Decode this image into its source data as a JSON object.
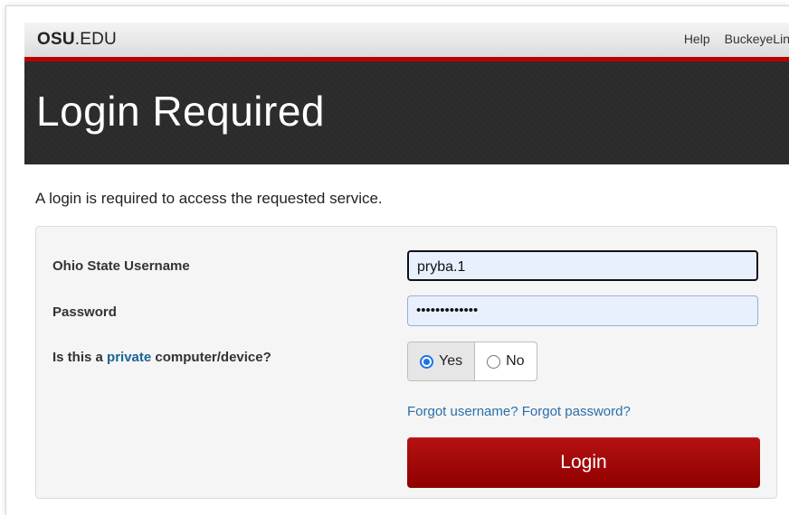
{
  "header": {
    "brand_bold": "OSU",
    "brand_rest": ".EDU",
    "links": [
      "Help",
      "BuckeyeLin"
    ]
  },
  "banner": {
    "title": "Login Required"
  },
  "notice": "A login is required to access the requested service.",
  "form": {
    "username_label": "Ohio State Username",
    "username_value": "pryba.1",
    "password_label": "Password",
    "password_value": "•••••••••••••",
    "private_label_pre": "Is this a ",
    "private_label_link": "private",
    "private_label_post": " computer/device?",
    "yes_label": "Yes",
    "no_label": "No",
    "selected_option": "Yes",
    "forgot_username": "Forgot username?",
    "forgot_password": "Forgot password?",
    "login_label": "Login"
  },
  "colors": {
    "accent_red": "#bb0000",
    "banner_bg": "#2b2b2b",
    "link_blue": "#1a6496",
    "login_button": "#a00000"
  }
}
